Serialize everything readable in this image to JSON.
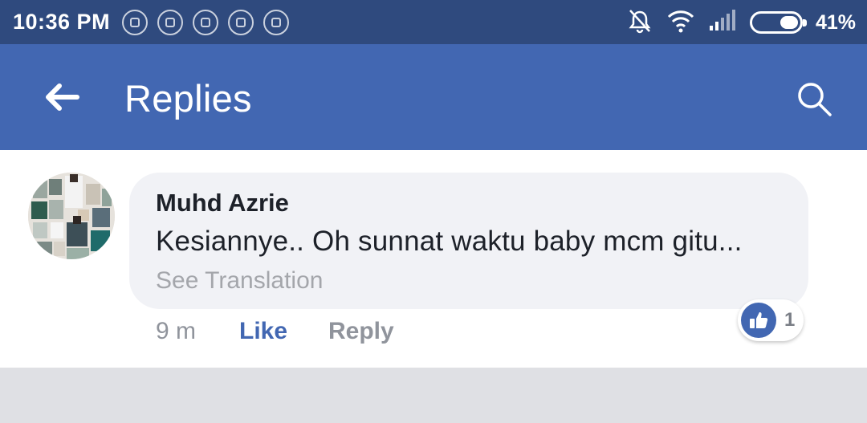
{
  "status_bar": {
    "time": "10:36 PM",
    "battery_percent": "41%",
    "battery_level": 0.41,
    "notification_icons": [
      "whatsapp-icon",
      "whatsapp-icon",
      "facebook-icon",
      "instagram-icon",
      "messenger-icon"
    ]
  },
  "app_bar": {
    "title": "Replies",
    "back_icon": "arrow-left-icon",
    "search_icon": "search-icon",
    "background_color": "#4267b2"
  },
  "comment": {
    "author": "Muhd Azrie",
    "text": "Kesiannye.. Oh sunnat waktu baby mcm gitu...",
    "see_translation": "See Translation",
    "time": "9 m",
    "like_label": "Like",
    "reply_label": "Reply",
    "reaction_count": "1",
    "reaction_icon": "thumbs-up-icon"
  }
}
